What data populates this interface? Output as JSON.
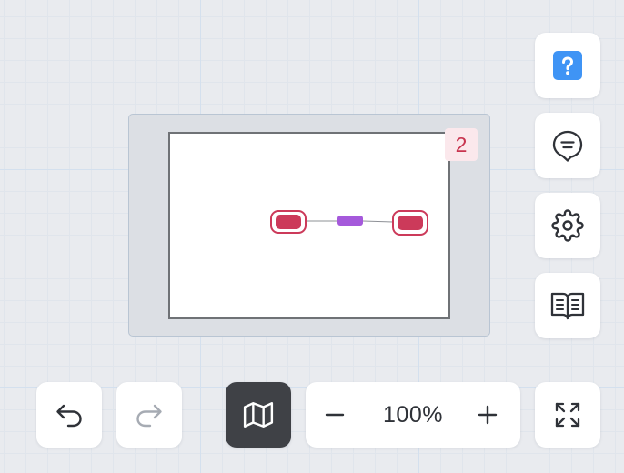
{
  "minimap": {
    "node_count_badge": "2",
    "nodes": [
      {
        "name": "minimap-node-left",
        "color": "#cc3a5a"
      },
      {
        "name": "minimap-node-middle",
        "color": "#a559db"
      },
      {
        "name": "minimap-node-right",
        "color": "#cc3a5a"
      }
    ]
  },
  "toolbar_right": {
    "help": {
      "icon": "help-icon",
      "accent": "#3f94f5"
    },
    "comment": {
      "icon": "comment-icon"
    },
    "settings": {
      "icon": "gear-icon"
    },
    "docs": {
      "icon": "book-icon"
    }
  },
  "toolbar_bottom": {
    "undo": {
      "icon": "undo-icon"
    },
    "redo": {
      "icon": "redo-icon"
    },
    "minimap_toggle": {
      "icon": "map-icon",
      "active": true
    },
    "zoom": {
      "level": "100%",
      "out_icon": "minus-icon",
      "in_icon": "plus-icon"
    },
    "fullscreen": {
      "icon": "fullscreen-icon"
    }
  },
  "colors": {
    "canvas_background": "#e9ebef",
    "button_background": "#ffffff",
    "button_active_background": "#3f4146",
    "icon_color": "#2f3238",
    "redo_disabled_color": "#a6abb3",
    "node_red": "#cc3a5a",
    "node_purple": "#a559db",
    "badge_text": "#c8344f",
    "badge_background": "#fbe8ec"
  }
}
